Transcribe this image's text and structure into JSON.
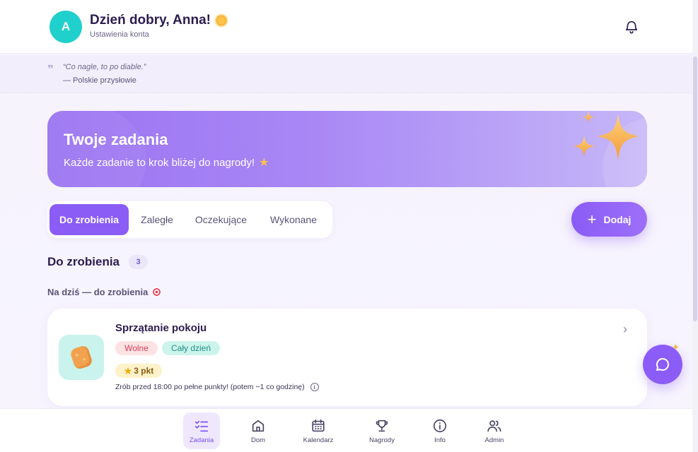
{
  "header": {
    "avatar_letter": "A",
    "greeting": "Dzień dobry, Anna!",
    "account_link": "Ustawienia konta"
  },
  "quote": {
    "text": "“Co nagle, to po diable.”",
    "author": "— Polskie przysłowie"
  },
  "hero": {
    "title": "Twoje zadania",
    "subtitle": "Każde zadanie to krok bliżej do nagrody!"
  },
  "tabs": [
    {
      "label": "Do zrobienia",
      "active": true
    },
    {
      "label": "Zaległe",
      "active": false
    },
    {
      "label": "Oczekujące",
      "active": false
    },
    {
      "label": "Wykonane",
      "active": false
    }
  ],
  "add_button": {
    "label": "Dodaj"
  },
  "section": {
    "title": "Do zrobienia",
    "count": "3",
    "subheading": "Na dziś — do zrobienia"
  },
  "tasks": [
    {
      "icon": "sponge-icon",
      "title": "Sprzątanie pokoju",
      "chips": [
        "Wolne",
        "Cały dzień"
      ],
      "points": "3 pkt",
      "note": "Zrób przed 18:00 po pełne punkty! (potem −1 co godzinę)"
    }
  ],
  "bottom_nav": [
    {
      "label": "Zadania",
      "icon": "tasks-icon",
      "active": true
    },
    {
      "label": "Dom",
      "icon": "home-icon",
      "active": false
    },
    {
      "label": "Kalendarz",
      "icon": "calendar-icon",
      "active": false
    },
    {
      "label": "Nagrody",
      "icon": "trophy-icon",
      "active": false
    },
    {
      "label": "Info",
      "icon": "info-icon",
      "active": false
    },
    {
      "label": "Admin",
      "icon": "users-icon",
      "active": false
    }
  ],
  "colors": {
    "accent": "#8b5cf6",
    "avatar": "#20d0cc",
    "text": "#2b1d4f"
  }
}
